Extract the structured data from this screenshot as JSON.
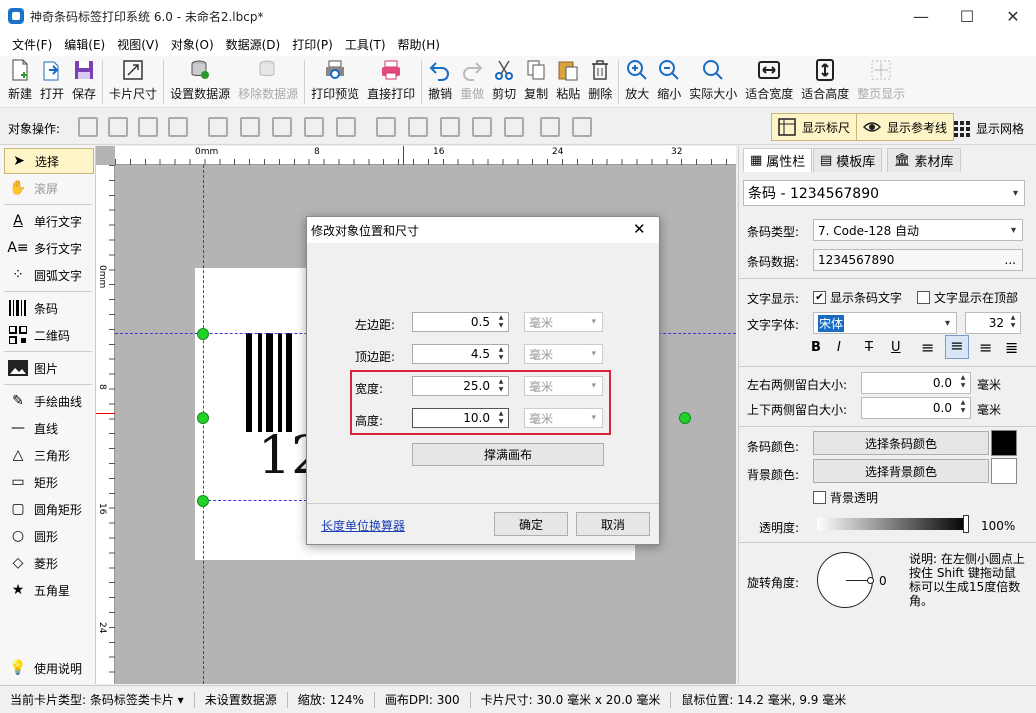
{
  "window": {
    "title": "神奇条码标签打印系统 6.0 - 未命名2.lbcp*",
    "minimize": "—",
    "maximize": "☐",
    "close": "✕"
  },
  "menu": [
    "文件(F)",
    "编辑(E)",
    "视图(V)",
    "对象(O)",
    "数据源(D)",
    "打印(P)",
    "工具(T)",
    "帮助(H)"
  ],
  "toolbar": {
    "new": "新建",
    "open": "打开",
    "save": "保存",
    "card_size": "卡片尺寸",
    "set_datasource": "设置数据源",
    "remove_datasource": "移除数据源",
    "print_preview": "打印预览",
    "direct_print": "直接打印",
    "undo": "撤销",
    "redo": "重做",
    "cut": "剪切",
    "copy": "复制",
    "paste": "粘贴",
    "delete": "删除",
    "zoom_in": "放大",
    "zoom_out": "缩小",
    "actual_size": "实际大小",
    "fit_width": "适合宽度",
    "fit_height": "适合高度",
    "full_page": "整页显示"
  },
  "objbar": {
    "label": "对象操作:",
    "show_ruler": "显示标尺",
    "show_guides": "显示参考线",
    "show_grid": "显示网格"
  },
  "tools": {
    "select": "选择",
    "scroll": "滚屏",
    "single_text": "单行文字",
    "multi_text": "多行文字",
    "arc_text": "圆弧文字",
    "barcode": "条码",
    "qrcode": "二维码",
    "image": "图片",
    "freehand": "手绘曲线",
    "line": "直线",
    "triangle": "三角形",
    "rect": "矩形",
    "round_rect": "圆角矩形",
    "circle": "圆形",
    "diamond": "菱形",
    "star": "五角星",
    "help": "使用说明"
  },
  "ruler": {
    "h": [
      "0mm",
      "8",
      "16",
      "24",
      "32"
    ],
    "v": [
      "0mm",
      "8",
      "16",
      "24"
    ]
  },
  "canvas": {
    "barcode_text": "12"
  },
  "dialog": {
    "title": "修改对象位置和尺寸",
    "close": "✕",
    "left_label": "左边距:",
    "left_value": "0.5",
    "top_label": "顶边距:",
    "top_value": "4.5",
    "width_label": "宽度:",
    "width_value": "25.0",
    "height_label": "高度:",
    "height_value": "10.0",
    "unit": "毫米",
    "fill_button": "撑满画布",
    "converter_link": "长度单位换算器",
    "ok": "确定",
    "cancel": "取消"
  },
  "props": {
    "tab_props": "属性栏",
    "tab_templates": "模板库",
    "tab_assets": "素材库",
    "object": "条码 - 1234567890",
    "type_label": "条码类型:",
    "type_value": "7. Code-128 自动",
    "data_label": "条码数据:",
    "data_value": "1234567890",
    "data_more": "...",
    "text_display_label": "文字显示:",
    "show_text": "显示条码文字",
    "text_top": "文字显示在顶部",
    "font_label": "文字字体:",
    "font_value": "宋体",
    "font_size": "32",
    "lr_margin_label": "左右两侧留白大小:",
    "lr_margin_value": "0.0",
    "tb_margin_label": "上下两侧留白大小:",
    "tb_margin_value": "0.0",
    "margin_unit": "毫米",
    "bar_color_label": "条码颜色:",
    "bar_color_btn": "选择条码颜色",
    "bg_color_label": "背景颜色:",
    "bg_color_btn": "选择背景颜色",
    "bg_transparent": "背景透明",
    "opacity_label": "透明度:",
    "opacity_value": "100%",
    "rotate_label": "旋转角度:",
    "rotate_value": "0",
    "rotate_note": "说明: 在左侧小圆点上按住 Shift 键拖动鼠标可以生成15度倍数角。",
    "bar_color": "#000000",
    "bg_color": "#ffffff"
  },
  "status": {
    "card_type": "当前卡片类型: 条码标签类卡片 ▾",
    "datasource": "未设置数据源",
    "zoom": "缩放: 124%",
    "dpi": "画布DPI: 300",
    "card_size": "卡片尺寸: 30.0 毫米 x 20.0 毫米",
    "mouse": "鼠标位置: 14.2 毫米, 9.9 毫米"
  }
}
